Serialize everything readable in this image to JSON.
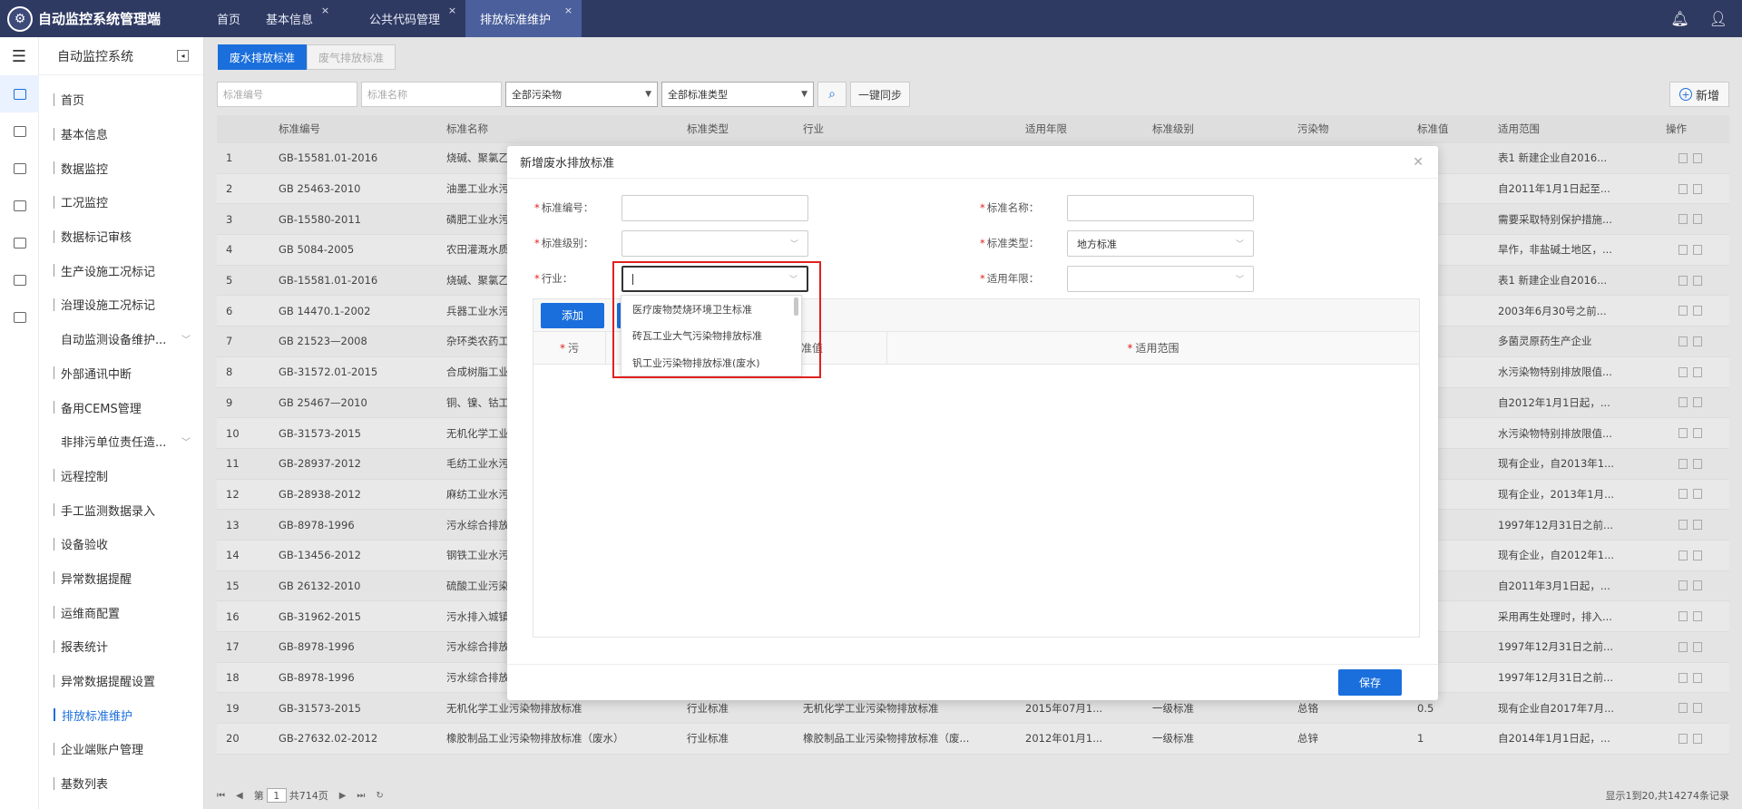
{
  "app": {
    "title": "自动监控系统管理端"
  },
  "top_tabs": [
    {
      "label": "首页",
      "closable": false,
      "active": false
    },
    {
      "label": "基本信息",
      "closable": true,
      "active": false
    },
    {
      "label": "公共代码管理",
      "closable": true,
      "active": false
    },
    {
      "label": "排放标准维护",
      "closable": true,
      "active": true
    }
  ],
  "close_glyph": "×",
  "top_icons": {
    "bell": "bell-icon",
    "user": "user-icon"
  },
  "sidebar": {
    "title": "自动监控系统",
    "items": [
      {
        "label": "首页",
        "group": false
      },
      {
        "label": "基本信息",
        "group": false
      },
      {
        "label": "数据监控",
        "group": false
      },
      {
        "label": "工况监控",
        "group": false
      },
      {
        "label": "数据标记审核",
        "group": false
      },
      {
        "label": "生产设施工况标记",
        "group": false
      },
      {
        "label": "治理设施工况标记",
        "group": false
      },
      {
        "label": "自动监测设备维护...",
        "group": true
      },
      {
        "label": "外部通讯中断",
        "group": false
      },
      {
        "label": "备用CEMS管理",
        "group": false
      },
      {
        "label": "非排污单位责任造...",
        "group": true
      },
      {
        "label": "远程控制",
        "group": false
      },
      {
        "label": "手工监测数据录入",
        "group": false
      },
      {
        "label": "设备验收",
        "group": false
      },
      {
        "label": "异常数据提醒",
        "group": false
      },
      {
        "label": "运维商配置",
        "group": false
      },
      {
        "label": "报表统计",
        "group": false
      },
      {
        "label": "异常数据提醒设置",
        "group": false
      },
      {
        "label": "排放标准维护",
        "group": false,
        "active": true
      },
      {
        "label": "企业端账户管理",
        "group": false
      },
      {
        "label": "基数列表",
        "group": false
      }
    ]
  },
  "sub_tabs": [
    "废水排放标准",
    "废气排放标准"
  ],
  "filters": {
    "code_placeholder": "标准编号",
    "name_placeholder": "标准名称",
    "pollutant_select": "全部污染物",
    "type_select": "全部标准类型",
    "sync_label": "一键同步",
    "add_label": "新增"
  },
  "table": {
    "headers": [
      "",
      "标准编号",
      "标准名称",
      "标准类型",
      "行业",
      "适用年限",
      "标准级别",
      "污染物",
      "标准值",
      "适用范围",
      "操作"
    ],
    "rows": [
      [
        "1",
        "GB-15581.01-2016",
        "烧碱、聚氯乙",
        "",
        "",
        "",
        "",
        "",
        "",
        "表1 新建企业自2016..."
      ],
      [
        "2",
        "GB 25463-2010",
        "油墨工业水污",
        "",
        "",
        "",
        "",
        "",
        "",
        "自2011年1月1日起至..."
      ],
      [
        "3",
        "GB-15580-2011",
        "磷肥工业水污",
        "",
        "",
        "",
        "",
        "",
        "",
        "需要采取特别保护措施..."
      ],
      [
        "4",
        "GB 5084-2005",
        "农田灌溉水质",
        "",
        "",
        "",
        "",
        "",
        "",
        "旱作，非盐碱土地区，..."
      ],
      [
        "5",
        "GB-15581.01-2016",
        "烧碱、聚氯乙",
        "",
        "",
        "",
        "",
        "",
        "",
        "表1 新建企业自2016..."
      ],
      [
        "6",
        "GB 14470.1-2002",
        "兵器工业水污",
        "",
        "",
        "",
        "",
        "",
        "",
        "2003年6月30号之前..."
      ],
      [
        "7",
        "GB 21523—2008",
        "杂环类农药工",
        "",
        "",
        "",
        "",
        "",
        "",
        "多菌灵原药生产企业"
      ],
      [
        "8",
        "GB-31572.01-2015",
        "合成树脂工业",
        "",
        "",
        "",
        "",
        "",
        "",
        "水污染物特别排放限值..."
      ],
      [
        "9",
        "GB 25467—2010",
        "铜、镍、钴工",
        "",
        "",
        "",
        "",
        "",
        "",
        "自2012年1月1日起，..."
      ],
      [
        "10",
        "GB-31573-2015",
        "无机化学工业",
        "",
        "",
        "",
        "",
        "",
        "",
        "水污染物特别排放限值..."
      ],
      [
        "11",
        "GB-28937-2012",
        "毛纺工业水污",
        "",
        "",
        "",
        "",
        "",
        "",
        "现有企业，自2013年1..."
      ],
      [
        "12",
        "GB-28938-2012",
        "麻纺工业水污",
        "",
        "",
        "",
        "",
        "",
        "",
        "现有企业，2013年1月..."
      ],
      [
        "13",
        "GB-8978-1996",
        "污水综合排放",
        "",
        "",
        "",
        "",
        "",
        "",
        "1997年12月31日之前..."
      ],
      [
        "14",
        "GB-13456-2012",
        "钢铁工业水污",
        "",
        "",
        "",
        "",
        "",
        "",
        "现有企业，自2012年1..."
      ],
      [
        "15",
        "GB 26132-2010",
        "硫酸工业污染",
        "",
        "",
        "",
        "",
        "",
        "",
        "自2011年3月1日起，..."
      ],
      [
        "16",
        "GB-31962-2015",
        "污水排入城镇",
        "",
        "",
        "",
        "",
        "",
        "",
        "采用再生处理时，排入..."
      ],
      [
        "17",
        "GB-8978-1996",
        "污水综合排放",
        "",
        "",
        "",
        "",
        "",
        "",
        "1997年12月31日之前..."
      ],
      [
        "18",
        "GB-8978-1996",
        "污水综合排放",
        "",
        "",
        "",
        "",
        "",
        "",
        "1997年12月31日之前..."
      ],
      [
        "19",
        "GB-31573-2015",
        "无机化学工业污染物排放标准",
        "行业标准",
        "无机化学工业污染物排放标准",
        "2015年07月1...",
        "一级标准",
        "总铬",
        "0.5",
        "现有企业自2017年7月..."
      ],
      [
        "20",
        "GB-27632.02-2012",
        "橡胶制品工业污染物排放标准（废水）",
        "行业标准",
        "橡胶制品工业污染物排放标准（废...",
        "2012年01月1...",
        "一级标准",
        "总锌",
        "1",
        "自2014年1月1日起，..."
      ]
    ]
  },
  "pager": {
    "page_prefix": "第",
    "page": "1",
    "total_pages": "共714页",
    "summary": "显示1到20,共14274条记录"
  },
  "modal": {
    "title": "新增废水排放标准",
    "fields": {
      "code_label": "标准编号：",
      "name_label": "标准名称：",
      "level_label": "标准级别：",
      "type_label": "标准类型：",
      "type_value": "地方标准",
      "industry_label": "行业：",
      "years_label": "适用年限："
    },
    "add_button": "添加",
    "grid_headers": [
      "污",
      "准值",
      "适用范围"
    ],
    "save_button": "保存",
    "industry_options": [
      "医疗废物焚烧环境卫生标准",
      "砖瓦工业大气污染物排放标准",
      "钒工业污染物排放标准(废水)"
    ]
  }
}
